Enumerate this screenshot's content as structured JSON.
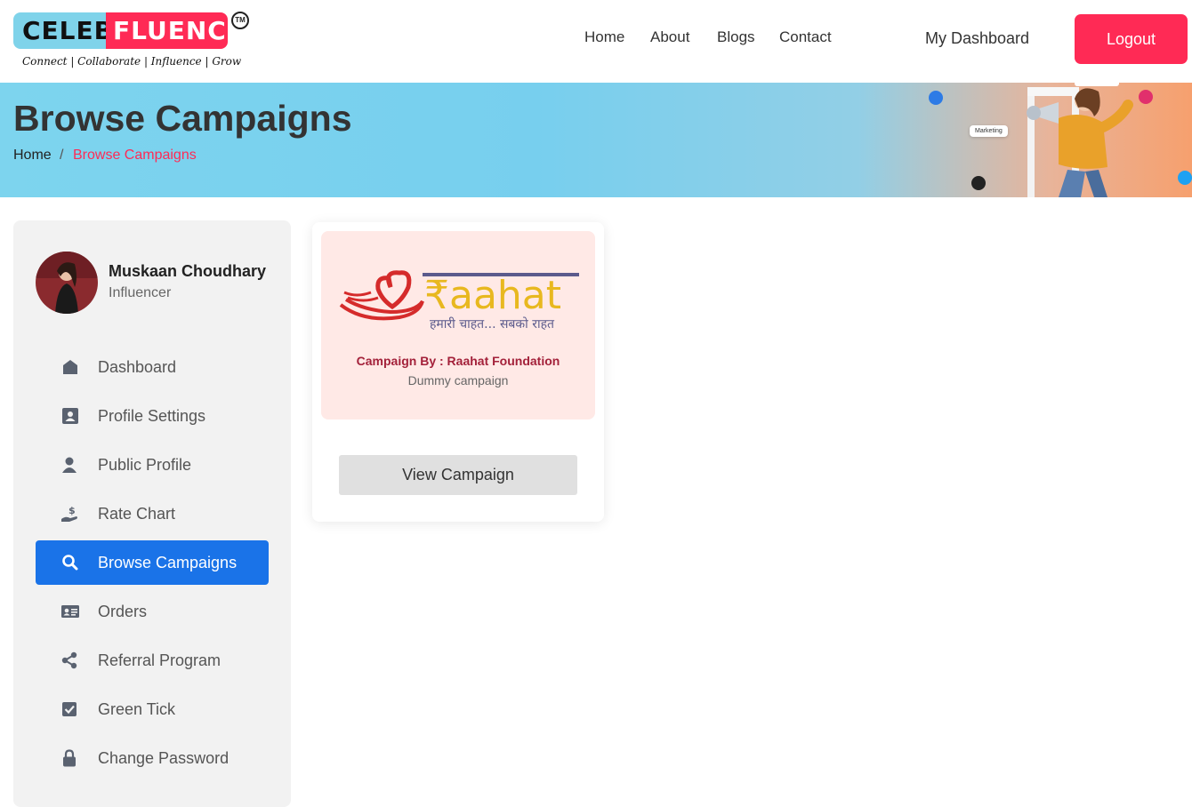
{
  "brand": {
    "part1": "CELEB",
    "part2": "FLUENCE",
    "tm": "TM",
    "tagline": "Connect | Collaborate | Influence | Grow",
    "color_primary": "#ff2a55",
    "color_secondary": "#7fd3ea"
  },
  "nav": {
    "home": "Home",
    "about": "About",
    "blogs": "Blogs",
    "contact": "Contact",
    "my_dashboard": "My Dashboard",
    "logout": "Logout"
  },
  "banner": {
    "title": "Browse Campaigns",
    "breadcrumb_home": "Home",
    "breadcrumb_sep": "/",
    "breadcrumb_current": "Browse Campaigns",
    "chip": "Marketing"
  },
  "user": {
    "name": "Muskaan Choudhary",
    "role": "Influencer"
  },
  "sidebar": {
    "active_color": "#1a73e8",
    "items": [
      {
        "label": "Dashboard",
        "icon": "home-icon"
      },
      {
        "label": "Profile Settings",
        "icon": "profile-card-icon"
      },
      {
        "label": "Public Profile",
        "icon": "user-icon"
      },
      {
        "label": "Rate Chart",
        "icon": "hand-dollar-icon"
      },
      {
        "label": "Browse Campaigns",
        "icon": "search-icon"
      },
      {
        "label": "Orders",
        "icon": "id-card-icon"
      },
      {
        "label": "Referral Program",
        "icon": "share-icon"
      },
      {
        "label": "Green Tick",
        "icon": "check-square-icon"
      },
      {
        "label": "Change Password",
        "icon": "lock-icon"
      }
    ]
  },
  "campaign": {
    "logo_text": "₹aahat",
    "logo_subtitle": "हमारी चाहत... सबको राहत",
    "by": "Campaign By : Raahat Foundation",
    "description": "Dummy campaign",
    "button": "View Campaign"
  }
}
